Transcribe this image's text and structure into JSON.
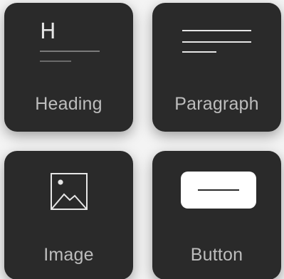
{
  "tiles": {
    "heading": {
      "label": "Heading",
      "glyph": "H",
      "icon": "heading-icon"
    },
    "paragraph": {
      "label": "Paragraph",
      "icon": "paragraph-icon"
    },
    "image": {
      "label": "Image",
      "icon": "image-icon"
    },
    "button": {
      "label": "Button",
      "icon": "button-icon"
    }
  },
  "colors": {
    "tile_background": "#2a2a2a",
    "label_text": "#bdbdbd",
    "icon_stroke": "#e6e6e6",
    "icon_muted": "#7a7a7a",
    "page_background": "#f4f4f4"
  }
}
